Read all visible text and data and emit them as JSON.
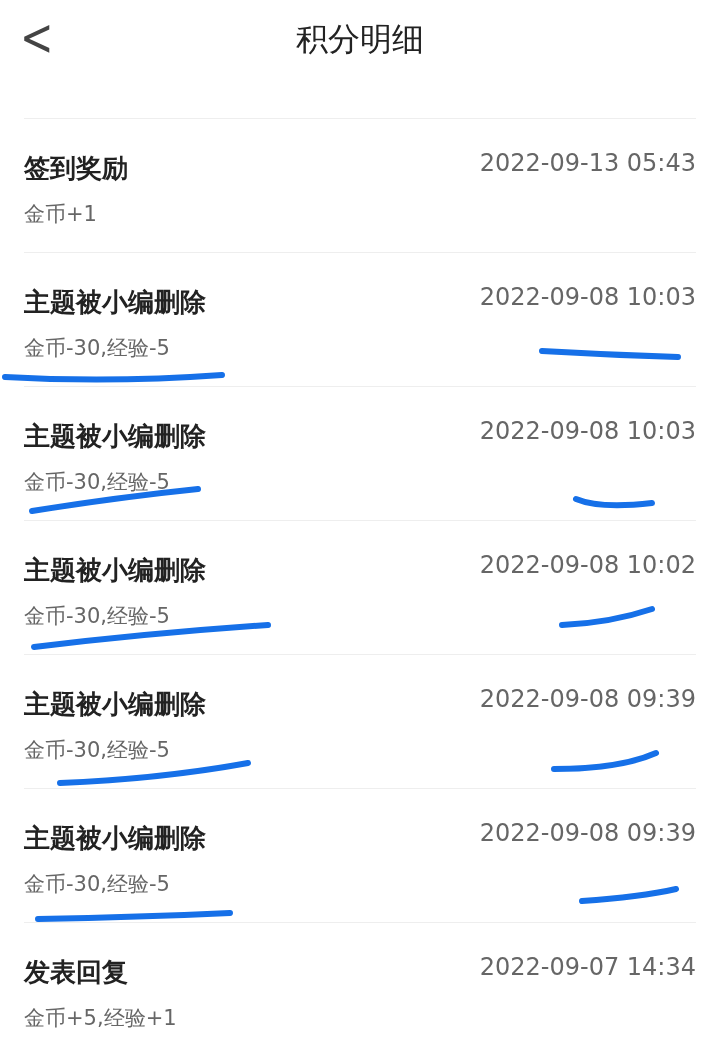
{
  "header": {
    "back": "<",
    "title": "积分明细"
  },
  "records": [
    {
      "title": "签到奖励",
      "detail": "金币+1",
      "time": "2022-09-13 05:43",
      "marked": false
    },
    {
      "title": "主题被小编删除",
      "detail": "金币-30,经验-5",
      "time": "2022-09-08 10:03",
      "marked": true
    },
    {
      "title": "主题被小编删除",
      "detail": "金币-30,经验-5",
      "time": "2022-09-08 10:03",
      "marked": true
    },
    {
      "title": "主题被小编删除",
      "detail": "金币-30,经验-5",
      "time": "2022-09-08 10:02",
      "marked": true
    },
    {
      "title": "主题被小编删除",
      "detail": "金币-30,经验-5",
      "time": "2022-09-08 09:39",
      "marked": true
    },
    {
      "title": "主题被小编删除",
      "detail": "金币-30,经验-5",
      "time": "2022-09-08 09:39",
      "marked": true
    },
    {
      "title": "发表回复",
      "detail": "金币+5,经验+1",
      "time": "2022-09-07 14:34",
      "marked": false
    }
  ]
}
